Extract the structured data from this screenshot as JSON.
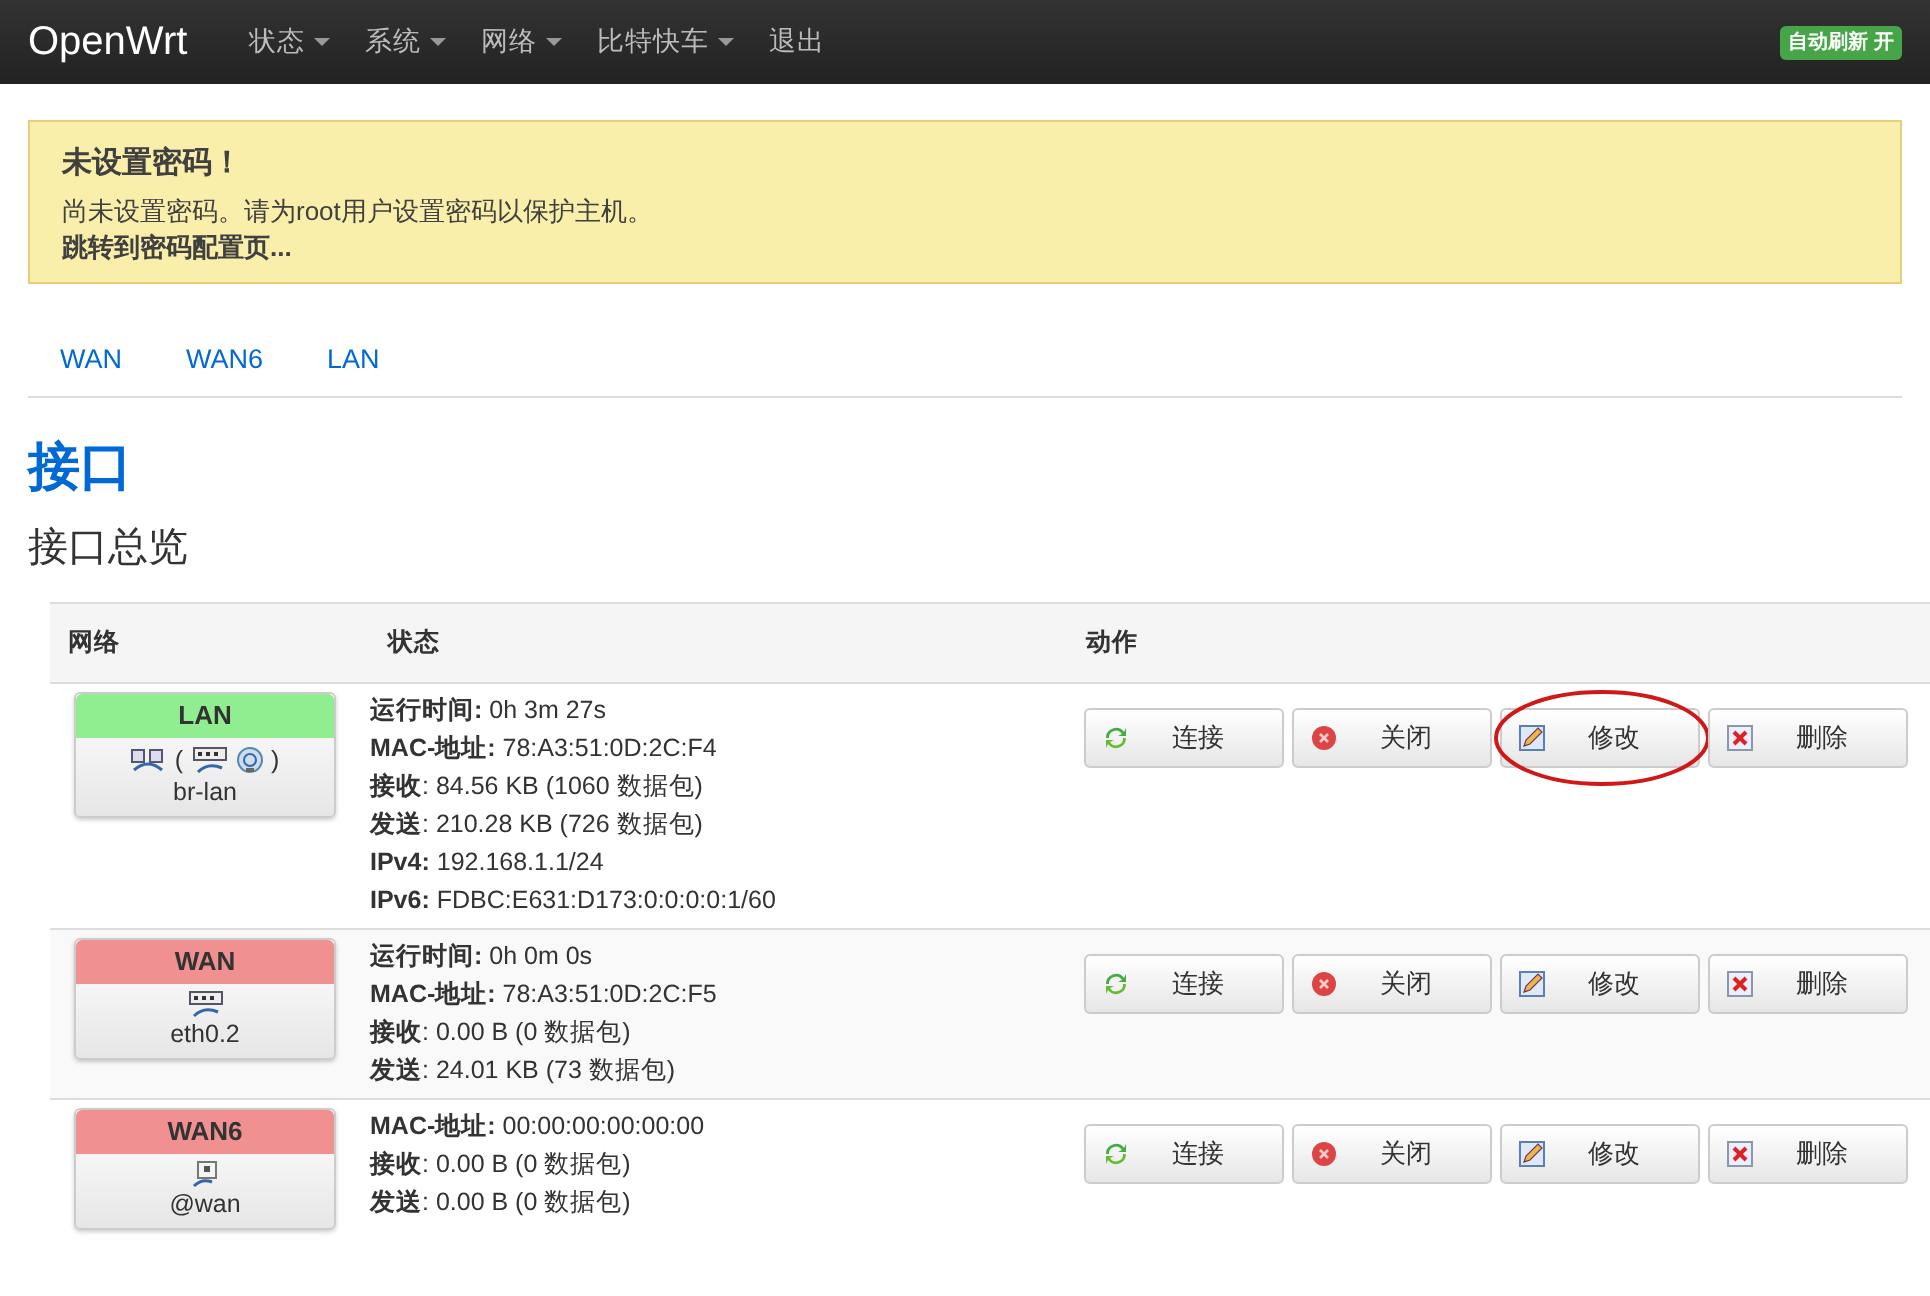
{
  "navbar": {
    "brand": "OpenWrt",
    "menus": [
      {
        "label": "状态",
        "dropdown": true
      },
      {
        "label": "系统",
        "dropdown": true
      },
      {
        "label": "网络",
        "dropdown": true
      },
      {
        "label": "比特快车",
        "dropdown": true
      },
      {
        "label": "退出",
        "dropdown": false
      }
    ],
    "refresh_badge": "自动刷新 开"
  },
  "alert": {
    "title": "未设置密码！",
    "text": "尚未设置密码。请为root用户设置密码以保护主机。",
    "link": "跳转到密码配置页..."
  },
  "tabs": [
    {
      "label": "WAN",
      "selected": false
    },
    {
      "label": "WAN6",
      "selected": false
    },
    {
      "label": "LAN",
      "selected": false
    }
  ],
  "heading": "接口",
  "subheading": "接口总览",
  "table": {
    "columns": [
      "网络",
      "状态",
      "动作"
    ],
    "rows": [
      {
        "name": "LAN",
        "color": "#90ee90",
        "device": "br-lan",
        "device_icons": [
          {
            "kind": "bridge"
          },
          {
            "kind": "text",
            "text": "("
          },
          {
            "kind": "switch"
          },
          {
            "kind": "wifi"
          },
          {
            "kind": "text",
            "text": ")"
          }
        ],
        "status": [
          "**运行时间:** 0h 3m 27s",
          "**MAC-地址:** 78:A3:51:0D:2C:F4",
          "**接收**: 84.56 KB (1060 数据包)",
          "**发送**: 210.28 KB (726 数据包)",
          "**IPv4:** 192.168.1.1/24",
          "**IPv6:** FDBC:E631:D173:0:0:0:0:1/60"
        ],
        "actions": [
          {
            "kind": "connect",
            "label": "连接",
            "circled": false
          },
          {
            "kind": "stop",
            "label": "关闭",
            "circled": false
          },
          {
            "kind": "edit",
            "label": "修改",
            "circled": true
          },
          {
            "kind": "delete",
            "label": "删除",
            "circled": false
          }
        ]
      },
      {
        "name": "WAN",
        "color": "#f09090",
        "device": "eth0.2",
        "device_icons": [
          {
            "kind": "switch"
          }
        ],
        "status": [
          "**运行时间:** 0h 0m 0s",
          "**MAC-地址:** 78:A3:51:0D:2C:F5",
          "**接收**: 0.00 B (0 数据包)",
          "**发送**: 24.01 KB (73 数据包)"
        ],
        "actions": [
          {
            "kind": "connect",
            "label": "连接",
            "circled": false
          },
          {
            "kind": "stop",
            "label": "关闭",
            "circled": false
          },
          {
            "kind": "edit",
            "label": "修改",
            "circled": false
          },
          {
            "kind": "delete",
            "label": "删除",
            "circled": false
          }
        ]
      },
      {
        "name": "WAN6",
        "color": "#f09090",
        "device": "@wan",
        "device_icons": [
          {
            "kind": "port"
          }
        ],
        "status": [
          "**MAC-地址:** 00:00:00:00:00:00",
          "**接收**: 0.00 B (0 数据包)",
          "**发送**: 0.00 B (0 数据包)"
        ],
        "actions": [
          {
            "kind": "connect",
            "label": "连接",
            "circled": false
          },
          {
            "kind": "stop",
            "label": "关闭",
            "circled": false
          },
          {
            "kind": "edit",
            "label": "修改",
            "circled": false
          },
          {
            "kind": "delete",
            "label": "删除",
            "circled": false
          }
        ]
      }
    ]
  }
}
